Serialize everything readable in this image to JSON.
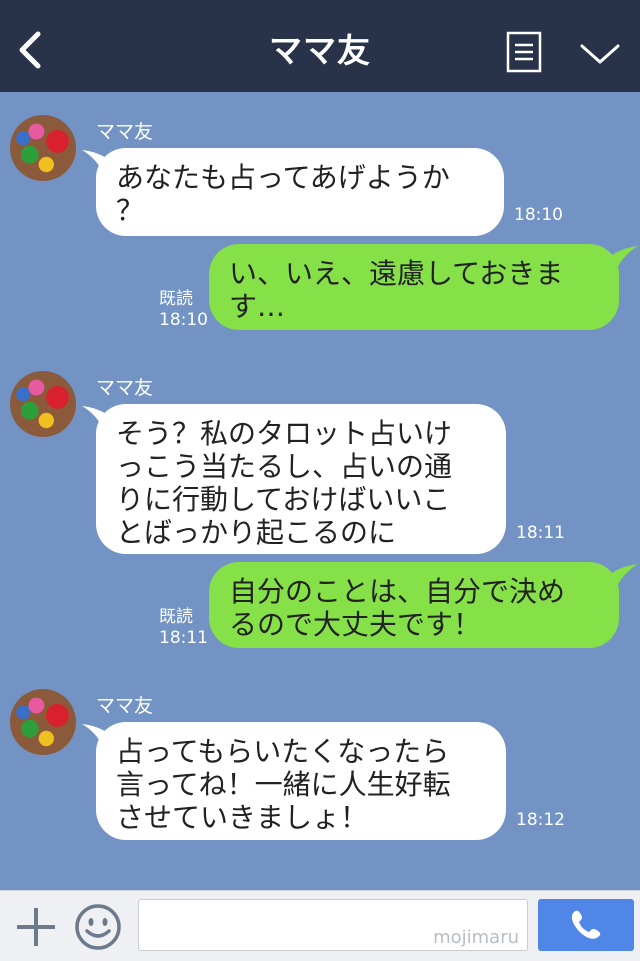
{
  "header": {
    "title": "ママ友",
    "back_icon": "chevron-left-icon",
    "menu_icon": "menu-list-icon",
    "collapse_icon": "chevron-down-icon"
  },
  "messages": [
    {
      "direction": "incoming",
      "sender": "ママ友",
      "lines": [
        "あなたも占ってあげようか",
        "？"
      ],
      "time": "18:10"
    },
    {
      "direction": "outgoing",
      "read": "既読",
      "lines": [
        "い、いえ、遠慮しておきま",
        "す…"
      ],
      "time": "18:10"
    },
    {
      "direction": "incoming",
      "sender": "ママ友",
      "lines": [
        "そう？私のタロット占いけ",
        "っこう当たるし、占いの通",
        "りに行動しておけばいいこ",
        "とばっかり起こるのに"
      ],
      "time": "18:11"
    },
    {
      "direction": "outgoing",
      "read": "既読",
      "lines": [
        "自分のことは、自分で決め",
        "るので大丈夫です！"
      ],
      "time": "18:11"
    },
    {
      "direction": "incoming",
      "sender": "ママ友",
      "lines": [
        "占ってもらいたくなったら",
        "言ってね！一緒に人生好転",
        "させていきましょ！"
      ],
      "time": "18:12"
    }
  ],
  "input_bar": {
    "plus_icon": "plus-icon",
    "emoji_icon": "smiley-icon",
    "placeholder": "",
    "watermark": "mojimaru",
    "call_icon": "phone-icon"
  },
  "colors": {
    "header_bg": "#283248",
    "chat_bg": "#7293c3",
    "incoming_bubble": "#ffffff",
    "outgoing_bubble": "#86e048",
    "call_button": "#4f86e8"
  }
}
